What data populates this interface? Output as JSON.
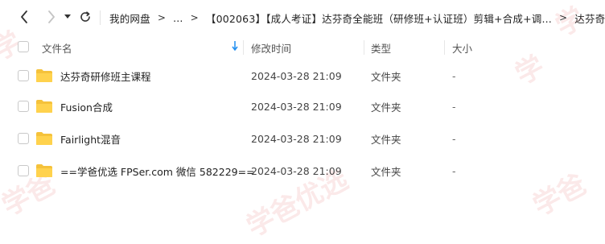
{
  "breadcrumb": [
    {
      "label": "我的网盘"
    },
    {
      "label": "..."
    },
    {
      "label": "【002063】【成人考证】达芬奇全能班（研修班+认证班）剪辑+合成+调..."
    },
    {
      "label": "达芬奇研修班"
    }
  ],
  "columns": {
    "name": "文件名",
    "time": "修改时间",
    "type": "类型",
    "size": "大小"
  },
  "files": [
    {
      "name": "达芬奇研修班主课程",
      "time": "2024-03-28 21:09",
      "type": "文件夹",
      "size": "-"
    },
    {
      "name": "Fusion合成",
      "time": "2024-03-28 21:09",
      "type": "文件夹",
      "size": "-"
    },
    {
      "name": "Fairlight混音",
      "time": "2024-03-28 21:09",
      "type": "文件夹",
      "size": "-"
    },
    {
      "name": "==学爸优选 FPSer.com 微信 582229==",
      "time": "2024-03-28 21:09",
      "type": "文件夹",
      "size": "-"
    }
  ],
  "watermark": "学爸优选",
  "colors": {
    "folder": "#f5c23b",
    "sort_arrow": "#1e8df0",
    "watermark": "#dc2828"
  }
}
